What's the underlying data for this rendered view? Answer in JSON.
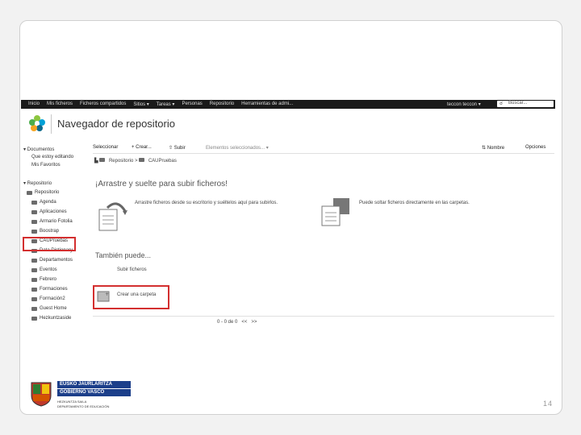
{
  "topbar": {
    "nav_items": [
      "Inicio",
      "Mis ficheros",
      "Ficheros compartidos",
      "Sitios ▾",
      "Tareas ▾",
      "Personas",
      "Repositorio",
      "Herramientas de admi..."
    ],
    "user": "teccon teccon ▾",
    "search_placeholder": "Buscar..."
  },
  "header": {
    "title": "Navegador de repositorio"
  },
  "sidebar": {
    "documents_heading": "▾ Documentos",
    "documents_items": [
      "Que estoy editando",
      "Mis Favoritos"
    ],
    "repo_heading": "▾ Repositorio",
    "repo_root": "Repositorio",
    "folders": [
      "Agenda",
      "Aplicaciones",
      "Armario Fotolia",
      "Boostrap",
      "CAUPruebas",
      "Data Dictionary",
      "Departamentos",
      "Eventos",
      "Febrero",
      "Formaciones",
      "Formación2",
      "Guest Home",
      "Hezkuntzaside"
    ]
  },
  "toolbar": {
    "select": "Seleccionar",
    "create": "Crear...",
    "upload": "Subir",
    "selected": "Elementos seleccionados... ▾",
    "sort": "Nombre",
    "options": "Opciones"
  },
  "breadcrumb": {
    "root": "Repositorio",
    "sep": ">",
    "current": "CAUPruebas"
  },
  "dropzone": {
    "title": "¡Arrastre y suelte para subir ficheros!",
    "text1": "Arrastre ficheros desde su escritorio y suéltelos aquí para subirlos.",
    "text2": "Puede soltar ficheros directamente en las carpetas."
  },
  "also": {
    "title": "También puede...",
    "upload": "Subir ficheros",
    "create_folder": "Crear una carpeta"
  },
  "pager": {
    "range": "0 - 0 de 0",
    "prev": "<<",
    "next": ">>"
  },
  "footer": {
    "gov_line1": "EUSKO JAURLARITZA",
    "gov_line2": "GOBIERNO VASCO",
    "dept_line1": "HEZKUNTZA SAILA",
    "dept_line2": "DEPARTAMENTO DE EDUCACIÓN"
  },
  "page_number": "14",
  "colors": {
    "highlight": "#d32f2f",
    "topbar": "#1a1a1a",
    "gov_blue": "#1c3f8a"
  }
}
